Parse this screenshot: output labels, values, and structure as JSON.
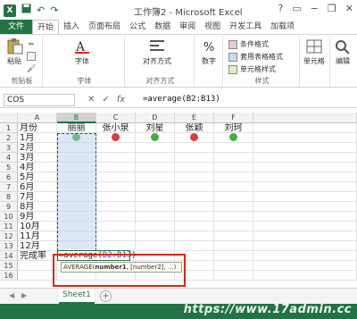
{
  "app": {
    "title": "工作簿2 - Microsoft Excel",
    "logo_text": "X",
    "brand_color": "#217346"
  },
  "quick_access": [
    "save-icon",
    "undo-icon",
    "redo-icon"
  ],
  "window_controls": [
    "?",
    "▭",
    "−",
    "❐",
    "✕"
  ],
  "tabs": [
    {
      "label": "文件",
      "type": "file"
    },
    {
      "label": "开始",
      "type": "active"
    },
    {
      "label": "插入"
    },
    {
      "label": "页面布局"
    },
    {
      "label": "公式"
    },
    {
      "label": "数据"
    },
    {
      "label": "审阅"
    },
    {
      "label": "视图"
    },
    {
      "label": "开发工具"
    },
    {
      "label": "加载项"
    }
  ],
  "ribbon": {
    "paste_label": "粘贴",
    "clipboard_group": "剪贴板",
    "font_button": "字体",
    "font_group": "字体",
    "align_button": "对齐方式",
    "align_group": "对齐方式",
    "number_button": "数字",
    "conditional_format": "条件格式",
    "table_format": "套用表格格式",
    "cell_style": "单元格样式",
    "styles_group": "样式",
    "cells_button": "单元格",
    "edit_button": "编辑"
  },
  "formula_bar": {
    "name_box": "COS",
    "cancel": "✕",
    "enter": "✓",
    "fx": "fx",
    "formula": "=average(B2:B13)"
  },
  "sheet": {
    "columns": [
      "A",
      "B",
      "C",
      "D",
      "E",
      "F"
    ],
    "rows": [
      "1",
      "2",
      "3",
      "4",
      "5",
      "6",
      "7",
      "8",
      "9",
      "10",
      "11",
      "12",
      "13",
      "14",
      "15",
      "16"
    ],
    "headers": {
      "A1": "月份",
      "B1": "丽丽",
      "C1": "张小泉",
      "D1": "刘星",
      "E1": "张颖",
      "F1": "刘珂"
    },
    "months": [
      "1月",
      "2月",
      "3月",
      "4月",
      "5月",
      "6月",
      "7月",
      "8月",
      "9月",
      "10月",
      "11月",
      "12月"
    ],
    "a14": "完成率",
    "status_dots": [
      {
        "col": "B",
        "color": "#3cb043"
      },
      {
        "col": "C",
        "color": "#e03a3a"
      },
      {
        "col": "D",
        "color": "#3cb043"
      },
      {
        "col": "E",
        "color": "#e03a3a"
      },
      {
        "col": "F",
        "color": "#3cb043"
      }
    ],
    "editing": {
      "prefix": "=average(",
      "ref": "B2:B13",
      "suffix": ")"
    },
    "tooltip": {
      "func": "AVERAGE(",
      "arg1": "number1",
      "rest": ", [number2], ...)"
    }
  },
  "sheet_tabs": {
    "prev": "◀",
    "next": "▶",
    "active": "Sheet1",
    "add": "+"
  },
  "watermark": "https://www.17admin.cc"
}
